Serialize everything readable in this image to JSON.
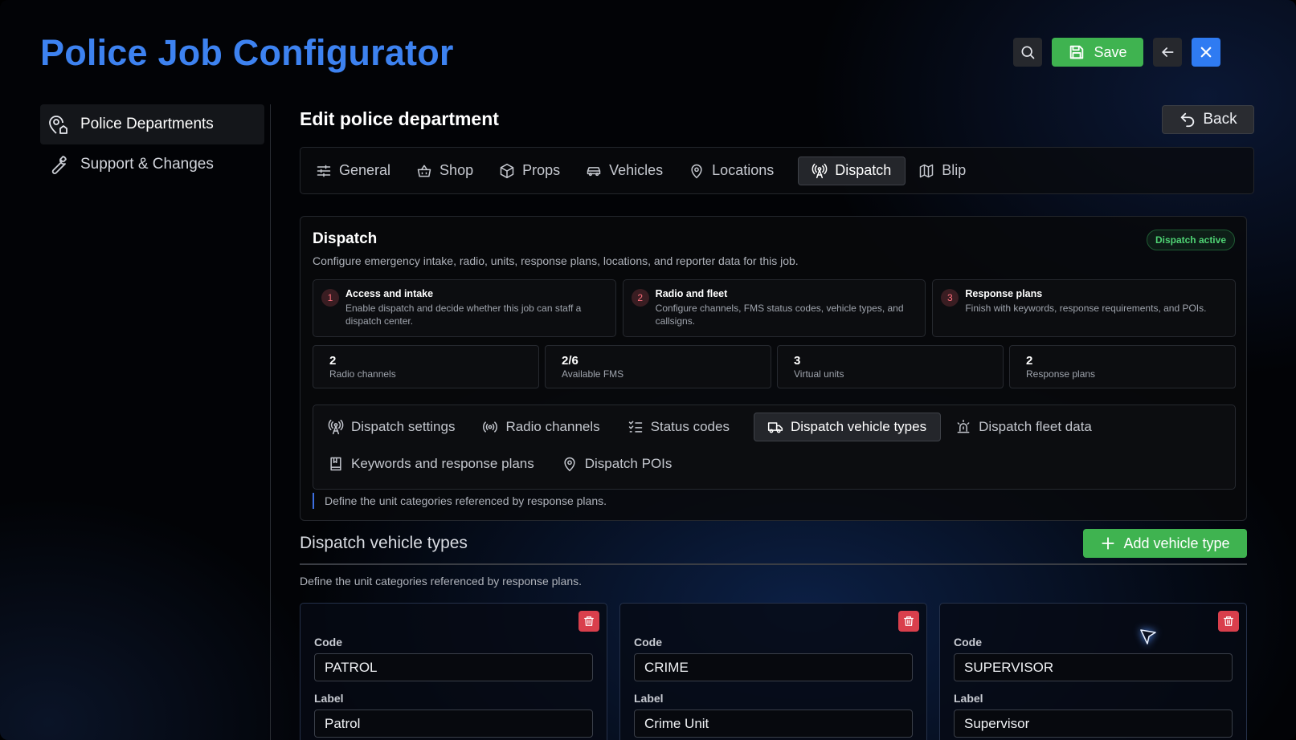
{
  "app": {
    "title": "Police Job Configurator"
  },
  "toolbar": {
    "save_label": "Save"
  },
  "sidebar": {
    "items": [
      {
        "label": "Police Departments",
        "icon": "map-pin-home-icon",
        "active": true
      },
      {
        "label": "Support & Changes",
        "icon": "wrench-icon",
        "active": false
      }
    ]
  },
  "page": {
    "title": "Edit police department",
    "back_label": "Back"
  },
  "tabs": [
    {
      "label": "General",
      "icon": "sliders-icon"
    },
    {
      "label": "Shop",
      "icon": "basket-icon"
    },
    {
      "label": "Props",
      "icon": "box-icon"
    },
    {
      "label": "Vehicles",
      "icon": "car-icon"
    },
    {
      "label": "Locations",
      "icon": "map-pin-icon"
    },
    {
      "label": "Dispatch",
      "icon": "radio-tower-icon",
      "active": true
    },
    {
      "label": "Blip",
      "icon": "map-icon"
    }
  ],
  "dispatch": {
    "title": "Dispatch",
    "status_badge": "Dispatch active",
    "subtitle": "Configure emergency intake, radio, units, response plans, locations, and reporter data for this job.",
    "steps": [
      {
        "number": "1",
        "title": "Access and intake",
        "description": "Enable dispatch and decide whether this job can staff a dispatch center."
      },
      {
        "number": "2",
        "title": "Radio and fleet",
        "description": "Configure channels, FMS status codes, vehicle types, and callsigns."
      },
      {
        "number": "3",
        "title": "Response plans",
        "description": "Finish with keywords, response requirements, and POIs."
      }
    ],
    "stats": [
      {
        "value": "2",
        "label": "Radio channels"
      },
      {
        "value": "2/6",
        "label": "Available FMS"
      },
      {
        "value": "3",
        "label": "Virtual units"
      },
      {
        "value": "2",
        "label": "Response plans"
      }
    ],
    "subtabs": [
      {
        "label": "Dispatch settings",
        "icon": "radio-tower-icon"
      },
      {
        "label": "Radio channels",
        "icon": "broadcast-icon"
      },
      {
        "label": "Status codes",
        "icon": "checklist-icon"
      },
      {
        "label": "Dispatch vehicle types",
        "icon": "truck-icon",
        "active": true
      },
      {
        "label": "Dispatch fleet data",
        "icon": "siren-icon"
      },
      {
        "label": "Keywords and response plans",
        "icon": "book-icon"
      },
      {
        "label": "Dispatch POIs",
        "icon": "map-pin-icon"
      }
    ],
    "hint": "Define the unit categories referenced by response plans."
  },
  "vehicle_types": {
    "title": "Dispatch vehicle types",
    "add_label": "Add vehicle type",
    "description": "Define the unit categories referenced by response plans.",
    "code_label": "Code",
    "label_label": "Label",
    "items": [
      {
        "code": "PATROL",
        "label": "Patrol"
      },
      {
        "code": "CRIME",
        "label": "Crime Unit"
      },
      {
        "code": "SUPERVISOR",
        "label": "Supervisor"
      }
    ]
  },
  "colors": {
    "accent_blue": "#3d82f0",
    "save_green": "#3fb350",
    "close_blue": "#2f7bf2",
    "delete_red": "#d93f4c",
    "active_green": "#4fd374"
  }
}
